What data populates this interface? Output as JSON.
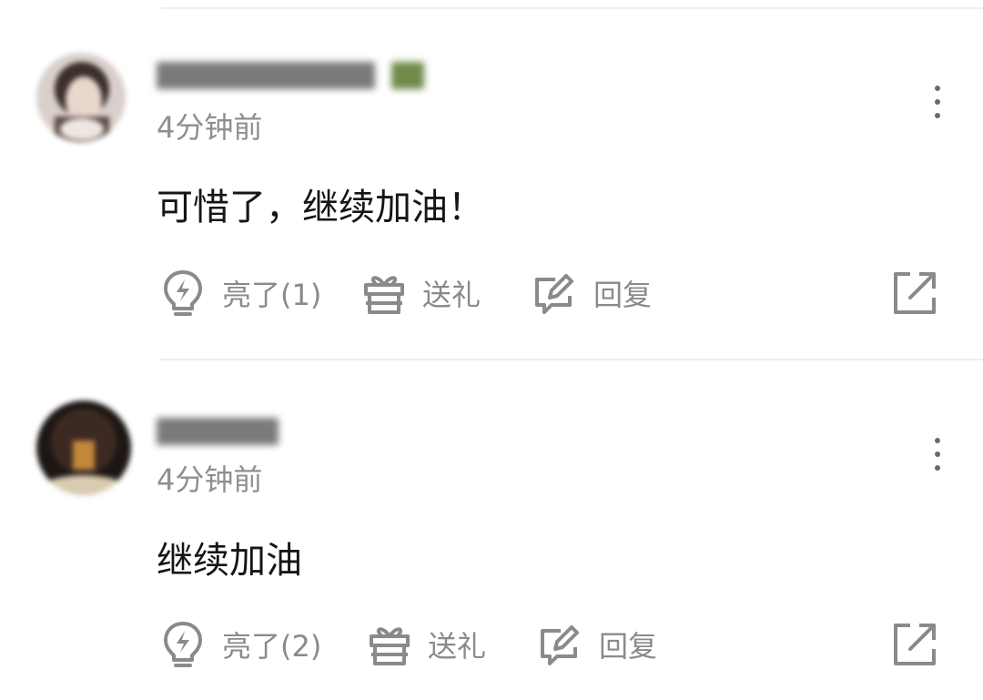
{
  "comments": [
    {
      "timestamp": "4分钟前",
      "text": "可惜了，继续加油！",
      "actions": {
        "like_label": "亮了(1)",
        "gift_label": "送礼",
        "reply_label": "回复"
      },
      "icons": [
        "lightbulb-icon",
        "gift-icon",
        "edit-reply-icon",
        "share-icon",
        "more-vertical-icon"
      ]
    },
    {
      "timestamp": "4分钟前",
      "text": "继续加油",
      "actions": {
        "like_label": "亮了(2)",
        "gift_label": "送礼",
        "reply_label": "回复"
      },
      "icons": [
        "lightbulb-icon",
        "gift-icon",
        "edit-reply-icon",
        "share-icon",
        "more-vertical-icon"
      ]
    }
  ],
  "colors": {
    "icon": "#8a8a8a",
    "text": "#151515",
    "meta": "#8f8f8f",
    "divider": "#efefef"
  }
}
